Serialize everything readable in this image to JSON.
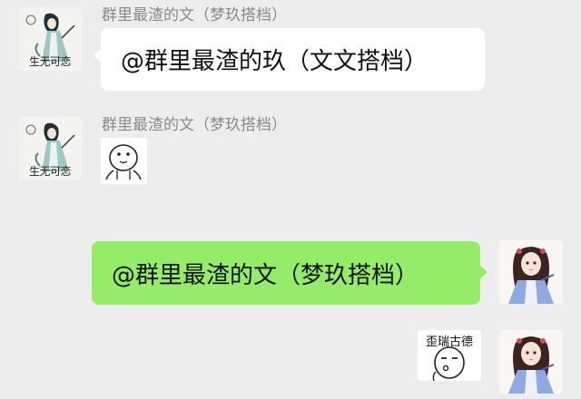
{
  "messages": [
    {
      "sender": "群里最渣的文（梦玖搭档）",
      "avatar_caption": "生无可恋",
      "text": "@群里最渣的玖（文文搭档）"
    },
    {
      "sender": "群里最渣的文（梦玖搭档）",
      "avatar_caption": "生无可恋",
      "sticker": "meme-face-sticker"
    },
    {
      "text": "@群里最渣的文（梦玖搭档）",
      "outgoing": true
    },
    {
      "sticker": "meme-face-sticker",
      "sticker_caption": "歪瑞古德",
      "outgoing": true
    }
  ],
  "colors": {
    "chat_background": "#ededed",
    "incoming_bubble": "#ffffff",
    "outgoing_bubble": "#95ec69",
    "sender_name": "#8a8a8a"
  }
}
